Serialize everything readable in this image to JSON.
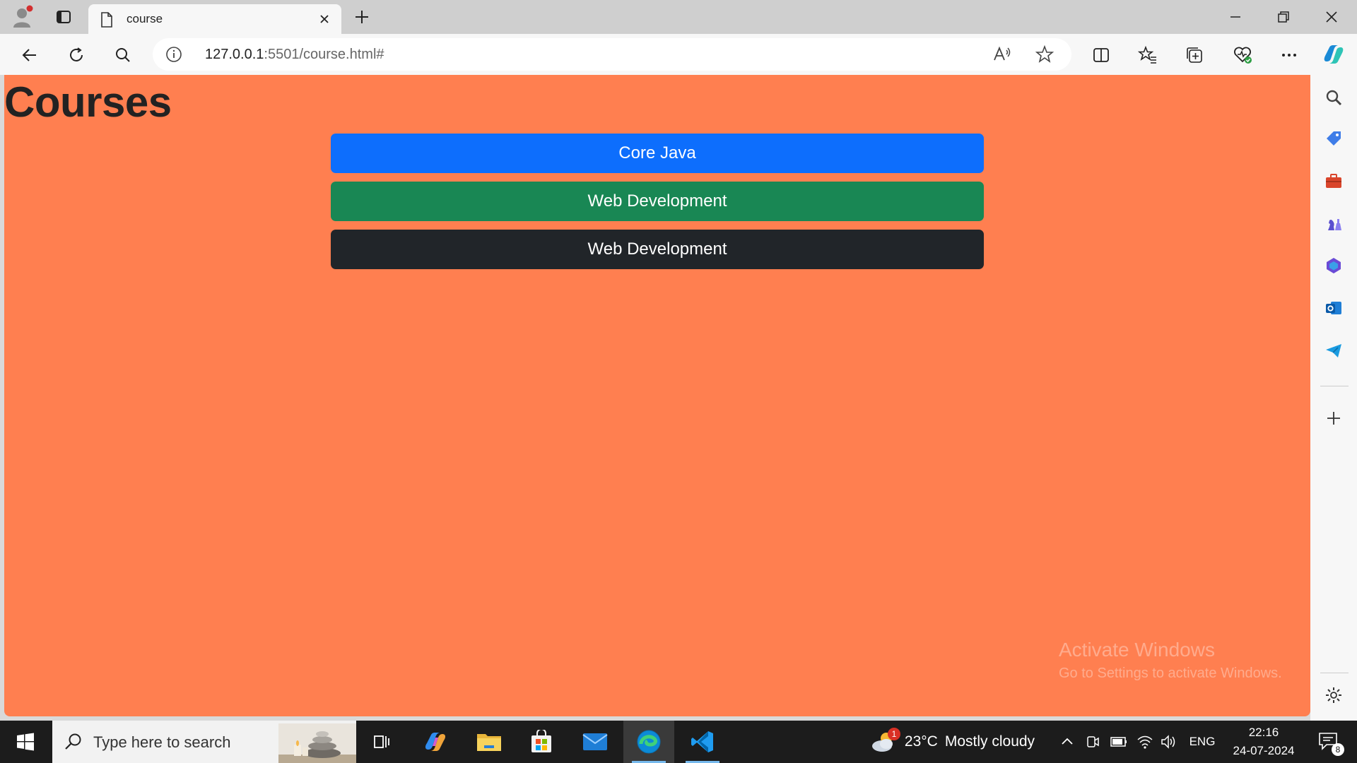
{
  "browser": {
    "tab": {
      "title": "course"
    },
    "url": {
      "host": "127.0.0.1",
      "rest": ":5501/course.html#"
    }
  },
  "page": {
    "title": "Courses",
    "buttons": [
      {
        "label": "Core Java",
        "color": "#0d6efd"
      },
      {
        "label": "Web Development",
        "color": "#198754"
      },
      {
        "label": "Web Development",
        "color": "#212529"
      }
    ],
    "background": "#ff7f50"
  },
  "watermark": {
    "line1": "Activate Windows",
    "line2": "Go to Settings to activate Windows."
  },
  "taskbar": {
    "search_placeholder": "Type here to search",
    "weather": {
      "temp": "23°C",
      "condition": "Mostly cloudy",
      "badge": "1"
    },
    "language": "ENG",
    "time": "22:16",
    "date": "24-07-2024",
    "notifications": "8"
  }
}
